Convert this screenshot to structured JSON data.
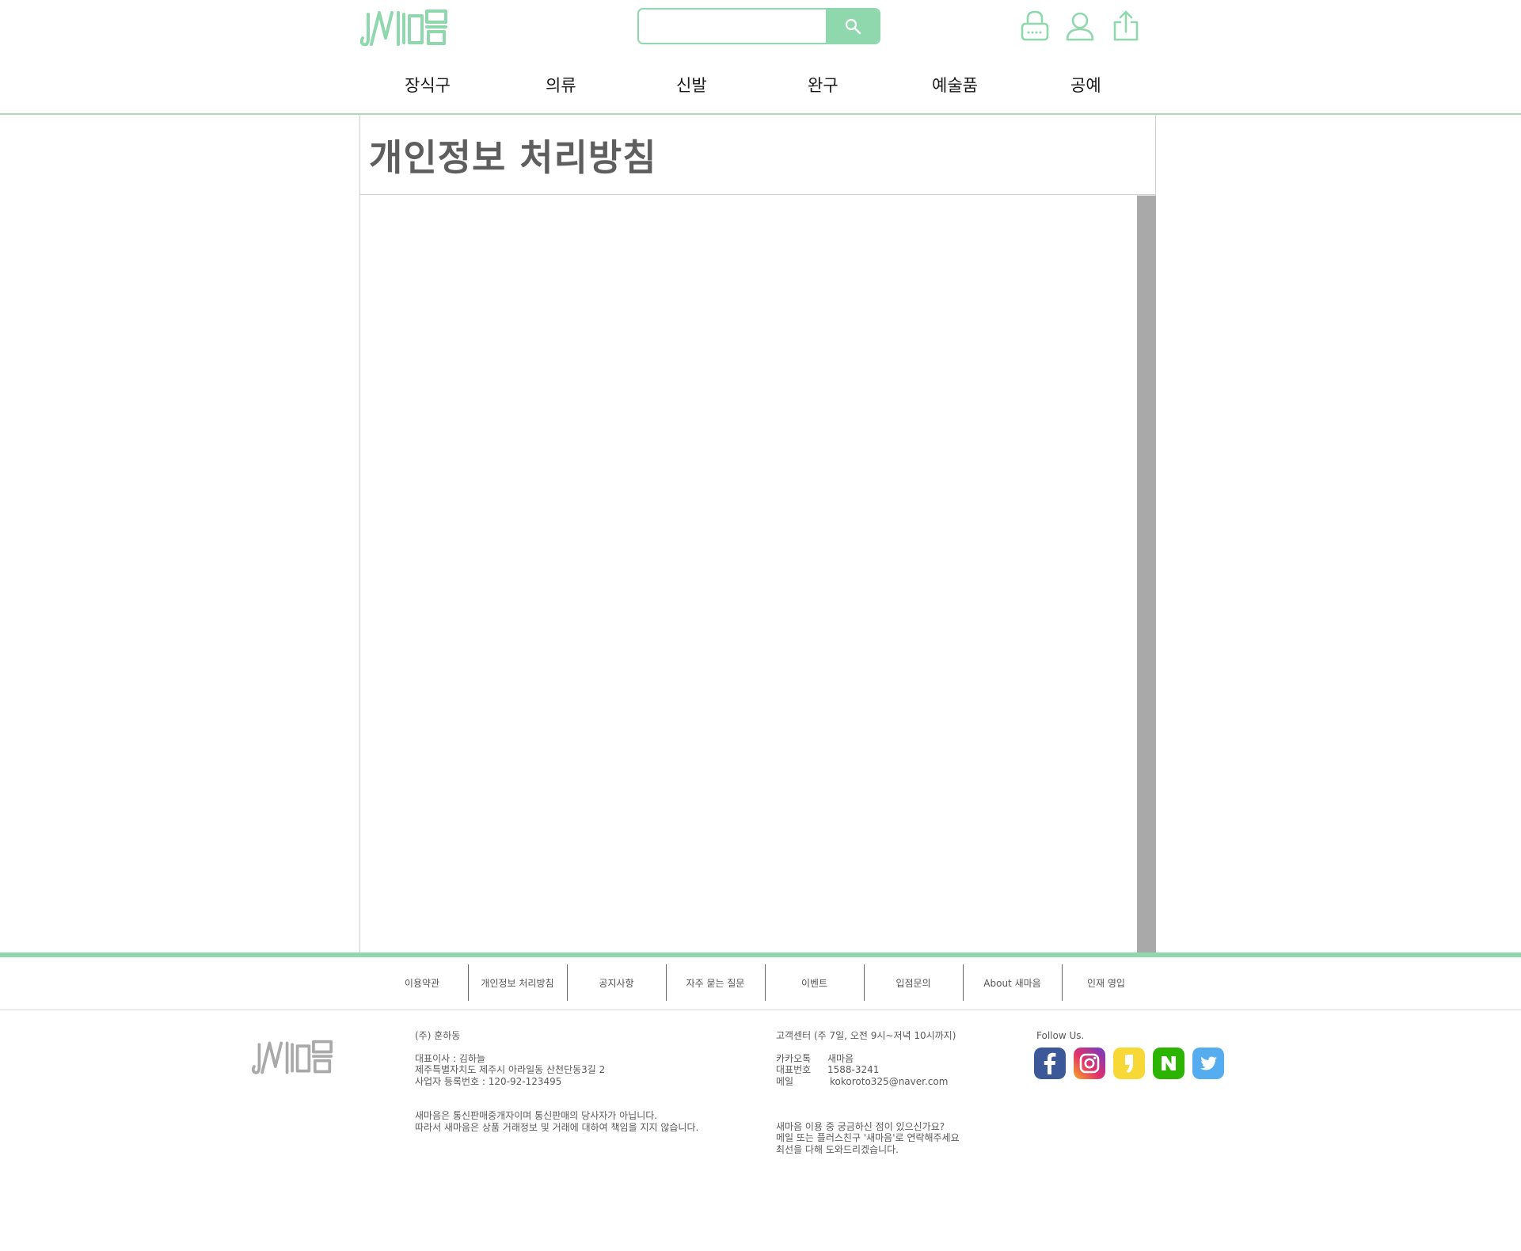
{
  "brand": {
    "name": "새마음",
    "color": "#8fd8ad"
  },
  "search": {
    "placeholder": "",
    "button_icon": "search-icon"
  },
  "header_icons": [
    "cart-lock-icon",
    "user-icon",
    "share-icon"
  ],
  "nav": {
    "items": [
      {
        "label": "장식구"
      },
      {
        "label": "의류"
      },
      {
        "label": "신발"
      },
      {
        "label": "완구"
      },
      {
        "label": "예술품"
      },
      {
        "label": "공예"
      }
    ]
  },
  "page": {
    "title": "개인정보 처리방침"
  },
  "footer": {
    "links": [
      {
        "label": "이용약관"
      },
      {
        "label": "개인정보 처리방침"
      },
      {
        "label": "공지사항"
      },
      {
        "label": "자주 묻는 질문"
      },
      {
        "label": "이벤트"
      },
      {
        "label": "입점문의"
      },
      {
        "label": "About 새마음"
      },
      {
        "label": "인재 영입"
      }
    ],
    "company": {
      "name": "(주) 훈하동",
      "ceo": "대표이사 : 김하늘",
      "address": "제주특별자치도 제주시 아라일동 산천단동3길 2",
      "biz_no": "사업자 등록번호 : 120-92-123495",
      "notice_1": "새마음은 통신판매중개자이며 통신판매의 당사자가 아닙니다.",
      "notice_2": "따라서 새마음은 상품 거래정보 및 거래에 대하여 책임을 지지 않습니다."
    },
    "support": {
      "hours": "고객센터 (주 7일, 오전 9시~저녁 10시까지)",
      "kakao_label": "카카오톡",
      "kakao_value": "새마음",
      "phone_label": "대표번호",
      "phone_value": "1588-3241",
      "mail_label": "메일",
      "mail_value": "kokoroto325@naver.com",
      "msg_1": "새마음 이용 중 궁금하신 점이 있으신가요?",
      "msg_2": "메일 또는 플러스친구 '새마음'로 연락해주세요",
      "msg_3": "최선을 다해 도와드리겠습니다."
    },
    "follow": {
      "label": "Follow Us.",
      "icons": [
        "facebook-icon",
        "instagram-icon",
        "kakaostory-icon",
        "naver-icon",
        "twitter-icon"
      ]
    }
  }
}
